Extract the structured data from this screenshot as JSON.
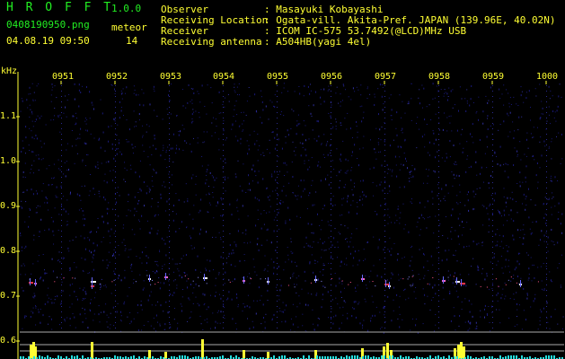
{
  "header": {
    "logo": "H R O F F T",
    "version": "1.0.0",
    "filename": "0408190950.png",
    "meteor_label": "meteor",
    "meteor_count": "14",
    "datetime": "04.08.19 09:50",
    "info": [
      {
        "label": "Observer",
        "value": ": Masayuki Kobayashi"
      },
      {
        "label": "Receiving Location",
        "value": ": Ogata-vill. Akita-Pref. JAPAN (139.96E, 40.02N)"
      },
      {
        "label": "Receiver",
        "value": ": ICOM IC-575 53.7492(@LCD)MHz USB"
      },
      {
        "label": "Receiving antenna",
        "value": ": A504HB(yagi 4el)"
      }
    ]
  },
  "axes": {
    "y_unit": "kHz",
    "y_ticks": [
      "1.1",
      "1.0",
      "0.9",
      "0.8",
      "0.7",
      "0.6"
    ],
    "time_ticks": [
      "0951",
      "0952",
      "0953",
      "0954",
      "0955",
      "0956",
      "0957",
      "0958",
      "0959",
      "1000"
    ]
  },
  "colors": {
    "background": "#000000",
    "noise": "#1a1a7a",
    "text_green": "#22ee22",
    "text_yellow": "#ffff33",
    "meteor": "#ff3344"
  }
}
